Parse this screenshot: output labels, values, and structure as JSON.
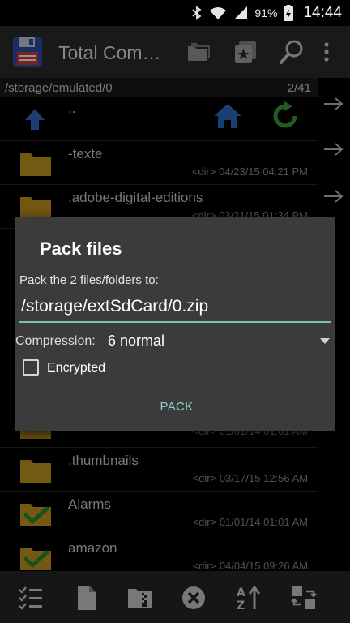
{
  "status_bar": {
    "battery_percent": "91%",
    "time": "14:44",
    "icons": [
      "bluetooth-icon",
      "wifi-icon",
      "signal-icon",
      "battery-charging-icon"
    ]
  },
  "action_bar": {
    "title": "Total Com…",
    "icons": [
      "app-floppy-icon",
      "folders-icon",
      "bookmarks-icon",
      "search-icon",
      "overflow-menu-icon"
    ]
  },
  "file_list": {
    "path": "/storage/emulated/0",
    "count": "2/41",
    "up_row": {
      "name": ".."
    },
    "rows": [
      {
        "name": "-texte",
        "type": "<dir>",
        "date": "04/23/15",
        "time": "04:21 PM",
        "checked": false
      },
      {
        "name": ".adobe-digital-editions",
        "type": "<dir>",
        "date": "03/21/15",
        "time": "01:34 PM",
        "checked": false
      },
      {
        "name": "",
        "type": "<dir>",
        "date": "01/01/14",
        "time": "01:01 AM",
        "checked": false
      },
      {
        "name": ".thumbnails",
        "type": "<dir>",
        "date": "03/17/15",
        "time": "12:56 AM",
        "checked": false
      },
      {
        "name": "Alarms",
        "type": "<dir>",
        "date": "01/01/14",
        "time": "01:01 AM",
        "checked": true
      },
      {
        "name": "amazon",
        "type": "<dir>",
        "date": "04/04/15",
        "time": "09:26 AM",
        "checked": true
      }
    ]
  },
  "dialog": {
    "title": "Pack files",
    "prompt": "Pack the 2 files/folders to:",
    "target_path": "/storage/extSdCard/0.zip",
    "compression_label": "Compression:",
    "compression_value": "6 normal",
    "encrypted_label": "Encrypted",
    "encrypted_checked": false,
    "pack_button": "PACK"
  },
  "toolbar": {
    "icons": [
      "select-icon",
      "new-file-icon",
      "zip-icon",
      "cancel-icon",
      "sort-icon",
      "swap-icon"
    ]
  },
  "colors": {
    "accent": "#8fd1ca",
    "folder": "#c79a20",
    "check_green": "#2e8b2e",
    "home_blue": "#2b6fc2",
    "refresh_green": "#3aa03a"
  }
}
